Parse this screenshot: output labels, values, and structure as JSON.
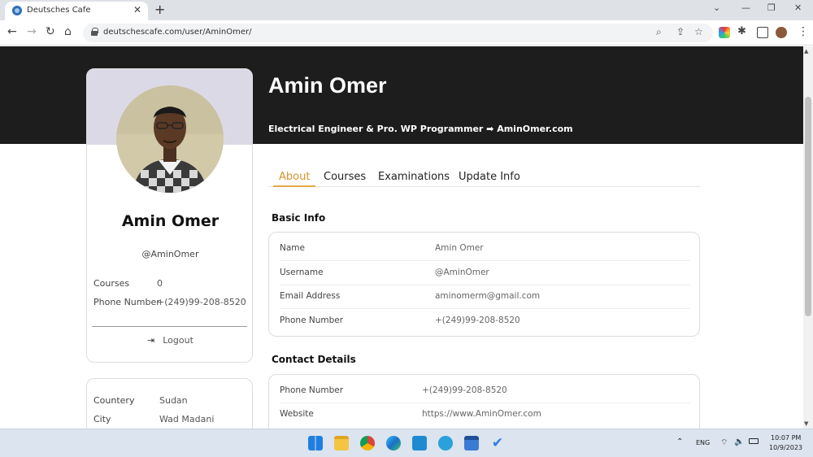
{
  "browser": {
    "tab_title": "Deutsches Cafe",
    "url": "deutschescafe.com/user/AminOmer/"
  },
  "hero": {
    "name": "Amin Omer",
    "subtitle": "Electrical Engineer & Pro. WP Programmer ➡ AminOmer.com"
  },
  "profile": {
    "name": "Amin Omer",
    "username": "@AminOmer",
    "rows": [
      {
        "label": "Courses",
        "value": "0"
      },
      {
        "label": "Phone Number",
        "value": "+(249)99-208-8520"
      }
    ],
    "logout_label": "Logout"
  },
  "location": {
    "rows": [
      {
        "label": "Countery",
        "value": "Sudan"
      },
      {
        "label": "City",
        "value": "Wad Madani"
      }
    ]
  },
  "tabs": [
    "About",
    "Courses",
    "Examinations",
    "Update Info"
  ],
  "basic_info": {
    "title": "Basic Info",
    "rows": [
      {
        "label": "Name",
        "value": "Amin Omer"
      },
      {
        "label": "Username",
        "value": "@AminOmer"
      },
      {
        "label": "Email Address",
        "value": "aminomerm@gmail.com"
      },
      {
        "label": "Phone Number",
        "value": "+(249)99-208-8520"
      }
    ]
  },
  "contact_details": {
    "title": "Contact Details",
    "rows": [
      {
        "label": "Phone Number",
        "value": "+(249)99-208-8520"
      },
      {
        "label": "Website",
        "value": "https://www.AminOmer.com"
      }
    ]
  },
  "taskbar": {
    "lang": "ENG",
    "time": "10:07 PM",
    "date": "10/9/2023",
    "app_icons": [
      "windows-start-icon",
      "file-explorer-icon",
      "chrome-icon",
      "edge-icon",
      "vscode-icon",
      "telegram-icon",
      "store-icon",
      "todo-icon"
    ]
  },
  "colors": {
    "hero_bg": "#1d1d1d",
    "accent": "#d9902b",
    "profile_bg": "#dcd9e7"
  }
}
